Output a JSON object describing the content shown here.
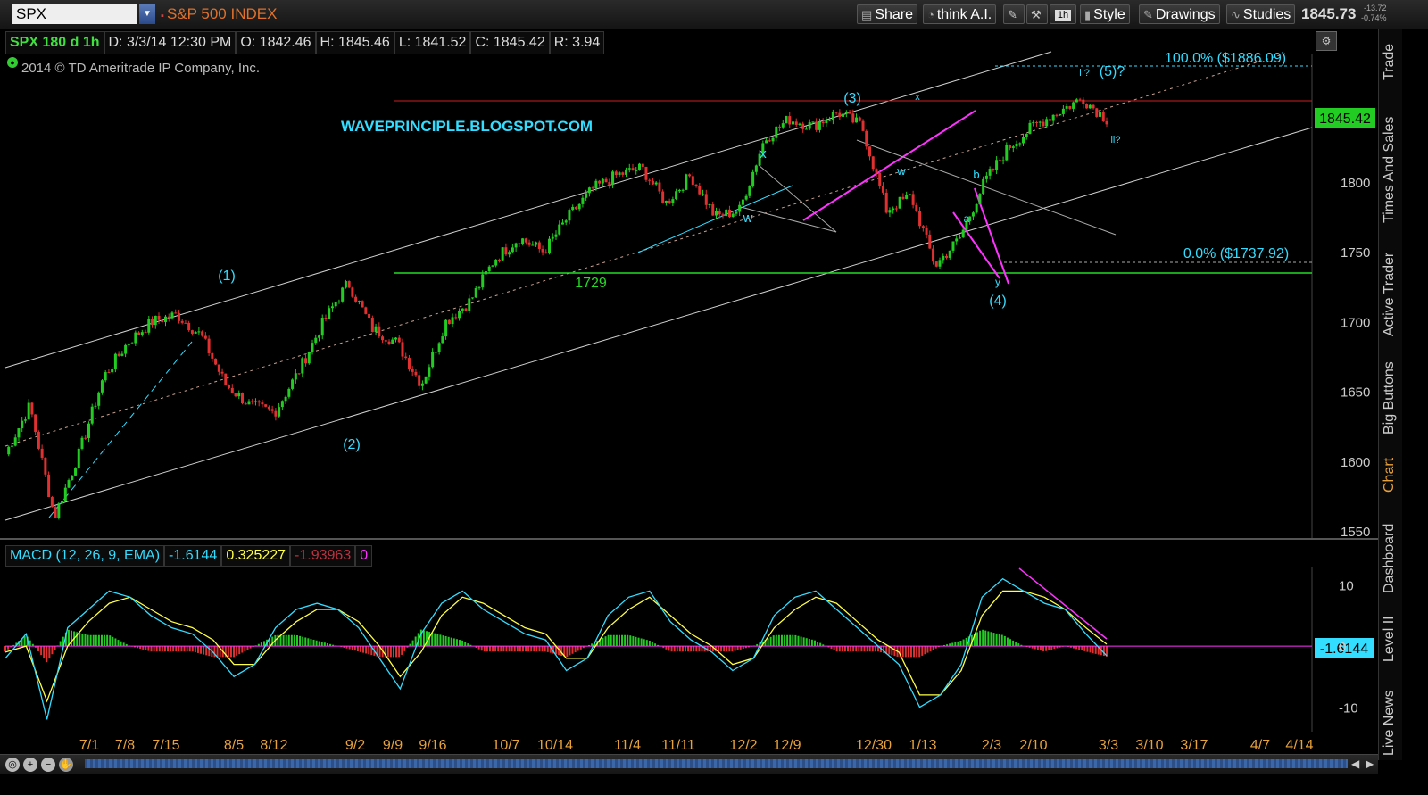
{
  "toolbar": {
    "symbol": "SPX",
    "symbol_name": "S&P 500 INDEX",
    "share_label": "Share",
    "thinkai_label": "think A.I.",
    "interval_label": "1h",
    "style_label": "Style",
    "drawings_label": "Drawings",
    "studies_label": "Studies",
    "last_price": "1845.73",
    "change_abs": "-13.72",
    "change_pct": "-0.74%"
  },
  "infobar": {
    "symbol_interval": "SPX 180 d 1h",
    "date": "D: 3/3/14 12:30 PM",
    "open": "O: 1842.46",
    "high": "H: 1845.46",
    "low": "L: 1841.52",
    "close": "C: 1845.42",
    "range": "R: 3.94"
  },
  "copyright": "2014 © TD Ameritrade IP Company, Inc.",
  "sidebar_tabs": [
    "Trade",
    "Times And Sales",
    "Active Trader",
    "Big Buttons",
    "Chart",
    "Dashboard",
    "Level II",
    "Live News"
  ],
  "colors": {
    "up": "#22cc22",
    "down": "#e03030",
    "macd_value": "#33ddff",
    "macd_avg": "#ffff44",
    "macd_diff": "#c03040",
    "annotation": "#33ddff",
    "channel": "#d0d0d0",
    "resistance": "#d02020",
    "support": "#22dd22",
    "magenta": "#ff33ff"
  },
  "annotations": {
    "watermark": "WAVEPRINCIPLE.BLOGSPOT.COM",
    "wave1": "(1)",
    "wave2": "(2)",
    "wave3": "(3)",
    "wave4": "(4)",
    "wave5": "(5)?",
    "sub_i": "i ?",
    "sub_ii": "ii?",
    "x_label": "x",
    "w_label": "w",
    "x2_label": "x",
    "w2_label": "w",
    "a_label": "a",
    "b_label": "b",
    "y_label": "y",
    "support_label": "1729",
    "fib_top": "100.0%  ($1886.09)",
    "fib_bottom": "0.0%  ($1737.92)"
  },
  "chart_data": [
    {
      "type": "line",
      "title": "SPX 180 d 1h",
      "price_label": "1845.42",
      "y_ticks": [
        1550,
        1600,
        1650,
        1700,
        1750,
        1800
      ],
      "ylim": [
        1545,
        1892
      ],
      "x_ticks": [
        "7/1",
        "7/8",
        "7/15",
        "8/5",
        "8/12",
        "9/2",
        "9/9",
        "9/16",
        "10/7",
        "10/14",
        "11/4",
        "11/11",
        "12/2",
        "12/9",
        "12/30",
        "1/13",
        "2/3",
        "2/10",
        "3/3",
        "3/10",
        "3/17",
        "4/7",
        "4/14"
      ],
      "series": [
        {
          "x": [
            "6/24",
            "6/28",
            "7/1",
            "7/8",
            "7/15",
            "7/22",
            "8/2",
            "8/5",
            "8/12",
            "8/20",
            "8/27",
            "9/2",
            "9/9",
            "9/16",
            "9/19",
            "9/25",
            "10/1",
            "10/8",
            "10/10",
            "10/14",
            "10/21",
            "10/28",
            "11/4",
            "11/11",
            "11/18",
            "11/22",
            "11/27",
            "12/2",
            "12/5",
            "12/9",
            "12/13",
            "12/20",
            "12/30",
            "1/8",
            "1/13",
            "1/15",
            "1/24",
            "1/28",
            "2/3",
            "2/5",
            "2/10",
            "2/14",
            "2/20",
            "2/25",
            "2/27",
            "3/3"
          ],
          "values": [
            1605,
            1640,
            1560,
            1605,
            1660,
            1685,
            1700,
            1705,
            1690,
            1655,
            1640,
            1635,
            1665,
            1700,
            1728,
            1695,
            1685,
            1655,
            1700,
            1715,
            1745,
            1760,
            1750,
            1775,
            1795,
            1805,
            1810,
            1785,
            1805,
            1775,
            1780,
            1830,
            1845,
            1840,
            1850,
            1840,
            1780,
            1790,
            1740,
            1760,
            1800,
            1825,
            1840,
            1850,
            1860,
            1845
          ]
        }
      ]
    },
    {
      "type": "line",
      "title": "MACD (12, 26, 9, EMA)",
      "values_shown": {
        "value": "-1.6144",
        "avg": "0.325227",
        "diff": "-1.93963",
        "zero": "0"
      },
      "price_label": "-1.6144",
      "y_ticks": [
        -10,
        0,
        10
      ],
      "ylim": [
        -14,
        13
      ],
      "series": [
        {
          "name": "Value",
          "values": [
            -2,
            2,
            -12,
            3,
            6,
            9,
            8,
            5,
            3,
            2,
            -1,
            -5,
            -3,
            3,
            6,
            7,
            6,
            3,
            -2,
            -7,
            2,
            7,
            9,
            6,
            4,
            2,
            1,
            -4,
            -2,
            5,
            8,
            9,
            4,
            1,
            -1,
            -4,
            -2,
            5,
            8,
            9,
            6,
            3,
            0,
            -3,
            -10,
            -8,
            -3,
            8,
            11,
            9,
            7,
            6,
            2,
            -1.6
          ]
        },
        {
          "name": "Avg",
          "values": [
            -1,
            0,
            -9,
            0,
            4,
            7,
            8,
            6,
            4,
            3,
            1,
            -3,
            -3,
            1,
            4,
            6,
            6,
            4,
            0,
            -5,
            -1,
            5,
            8,
            7,
            5,
            3,
            2,
            -2,
            -2,
            3,
            6,
            8,
            5,
            2,
            0,
            -3,
            -2,
            3,
            6,
            8,
            7,
            4,
            1,
            -1,
            -8,
            -8,
            -4,
            5,
            9,
            9,
            8,
            6,
            3,
            0.3
          ]
        }
      ]
    }
  ]
}
